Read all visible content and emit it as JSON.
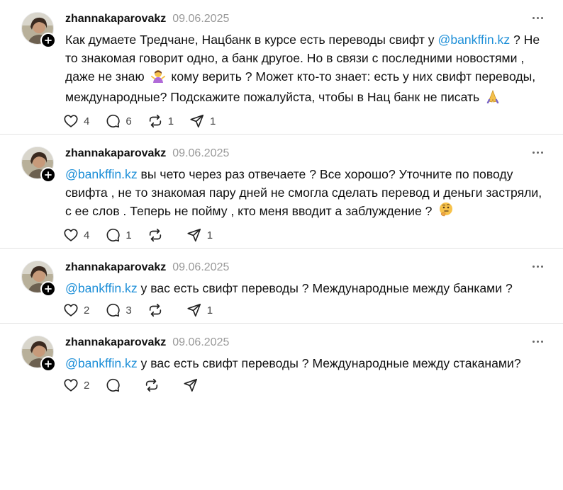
{
  "posts": [
    {
      "username": "zhannakaparovakz",
      "date": "09.06.2025",
      "segments": [
        {
          "t": "Как думаете Тредчане, Нацбанк в курсе есть переводы свифт у "
        },
        {
          "mention": "@bankffin.kz"
        },
        {
          "t": " ? Не то знакомая говорит одно, а банк другое. Но в связи с последними новостями , даже не знаю "
        },
        {
          "emoji": "shrug-person-emoji"
        },
        {
          "t": " кому верить ? Может кто-то знает: есть у них свифт переводы, международные? Подскажите пожалуйста, чтобы в Нац банк не писать "
        },
        {
          "emoji": "folded-hands-emoji"
        }
      ],
      "likes": "4",
      "replies": "6",
      "reposts": "1",
      "shares": "1"
    },
    {
      "username": "zhannakaparovakz",
      "date": "09.06.2025",
      "segments": [
        {
          "mention": "@bankffin.kz"
        },
        {
          "t": " вы чето через раз отвечаете ? Все хорошо? Уточните по поводу свифта , не то знакомая пару дней не смогла сделать перевод и деньги застряли, с ее слов . Теперь не пойму , кто меня вводит а заблуждение ? "
        },
        {
          "emoji": "thinking-face-emoji"
        }
      ],
      "likes": "4",
      "replies": "1",
      "reposts": "",
      "shares": "1"
    },
    {
      "username": "zhannakaparovakz",
      "date": "09.06.2025",
      "segments": [
        {
          "mention": "@bankffin.kz"
        },
        {
          "t": " у вас есть свифт переводы ? Международные между банками ?"
        }
      ],
      "likes": "2",
      "replies": "3",
      "reposts": "",
      "shares": "1"
    },
    {
      "username": "zhannakaparovakz",
      "date": "09.06.2025",
      "segments": [
        {
          "mention": "@bankffin.kz"
        },
        {
          "t": " у вас есть свифт переводы ? Международные между стаканами?"
        }
      ],
      "likes": "2",
      "replies": "",
      "reposts": "",
      "shares": ""
    }
  ],
  "icons": {
    "like": "heart-icon",
    "reply": "comment-icon",
    "repost": "repost-icon",
    "share": "share-icon",
    "more": "more-icon",
    "follow": "plus-icon"
  },
  "colors": {
    "mention": "#1d8fd8",
    "date": "#999999",
    "divider": "#e3e3e3",
    "text": "#101010"
  }
}
